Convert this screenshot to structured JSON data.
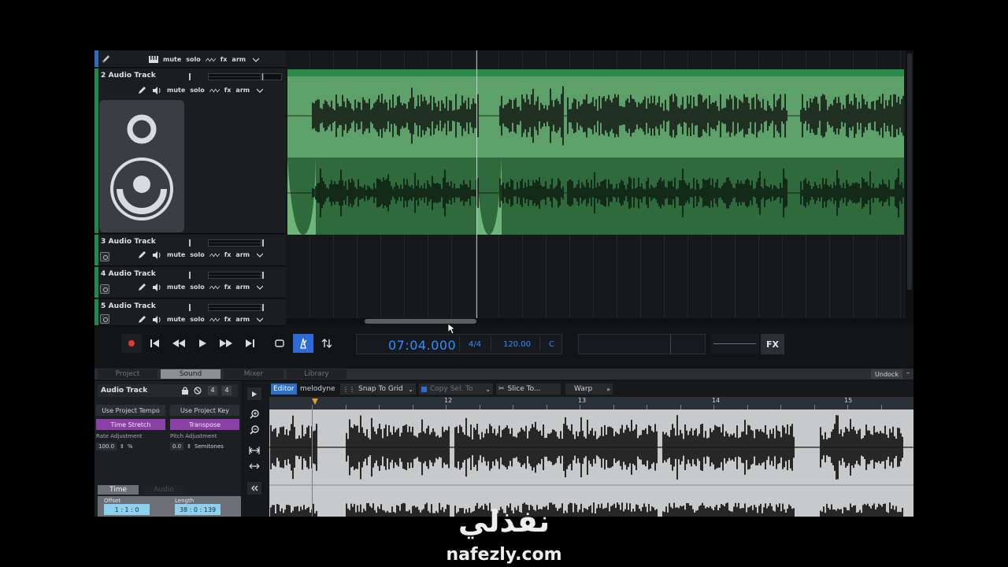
{
  "tracks": [
    {
      "name": "",
      "buttons": {
        "mute": "mute",
        "solo": "solo",
        "fx": "fx",
        "arm": "arm"
      }
    },
    {
      "name": "2 Audio Track",
      "buttons": {
        "mute": "mute",
        "solo": "solo",
        "fx": "fx",
        "arm": "arm"
      }
    },
    {
      "name": "3 Audio Track",
      "buttons": {
        "mute": "mute",
        "solo": "solo",
        "fx": "fx",
        "arm": "arm"
      }
    },
    {
      "name": "4 Audio Track",
      "buttons": {
        "mute": "mute",
        "solo": "solo",
        "fx": "fx",
        "arm": "arm"
      }
    },
    {
      "name": "5 Audio Track",
      "buttons": {
        "mute": "mute",
        "solo": "solo",
        "fx": "fx",
        "arm": "arm"
      }
    }
  ],
  "transport": {
    "time": "07:04.000",
    "signature": "4/4",
    "tempo": "120.00",
    "key": "C",
    "fx_label": "FX"
  },
  "panel_tabs": [
    "Project",
    "Sound",
    "Mixer",
    "Library"
  ],
  "active_panel_tab": "Sound",
  "undock_label": "Undock",
  "undock_close": "–",
  "sound_panel": {
    "title": "Audio Track",
    "num_a": "4",
    "num_b": "4",
    "use_project_tempo": "Use Project Tempo",
    "time_stretch": "Time Stretch",
    "rate_adjustment_label": "Rate Adjustment",
    "rate_value": "100.0",
    "rate_unit": "%",
    "use_project_key": "Use Project Key",
    "transpose": "Transpose",
    "pitch_adjustment_label": "Pitch Adjustment",
    "pitch_value": "0.0",
    "pitch_unit": "Semitones",
    "sub_tabs": [
      "Time",
      "Audio"
    ],
    "offset_label": "Offset",
    "offset_value": "1 : 1 : 0",
    "length_label": "Length",
    "length_value": "38 : 0 : 139"
  },
  "editor": {
    "editor_label": "Editor",
    "melodyne_label": "melodyne",
    "snap_label": "Snap To Grid",
    "copy_sel_label": "Copy Sel. To",
    "slice_label": "Slice To...",
    "warp_label": "Warp",
    "ruler_marks": [
      "12",
      "13",
      "14",
      "15"
    ]
  },
  "watermark": {
    "arabic": "نفذلي",
    "url": "nafezly.com"
  },
  "colors": {
    "clip_green": "#5ea06a",
    "clip_dark_green": "#2f6a3c",
    "lcd_blue": "#2e8fff",
    "record_red": "#e53935",
    "metronome_blue": "#2f6bd6",
    "purple_button": "#8b3fa8"
  }
}
